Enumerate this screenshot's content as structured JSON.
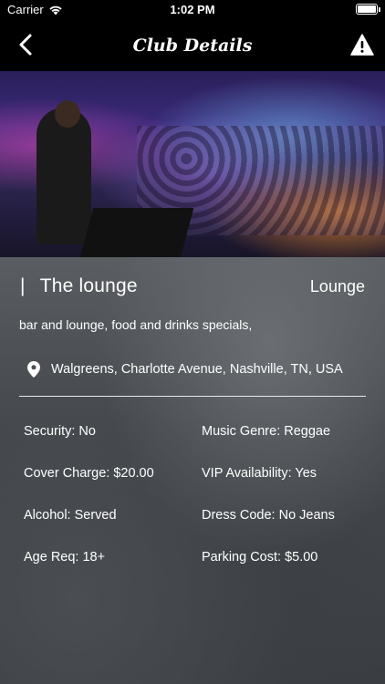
{
  "status_bar": {
    "carrier": "Carrier",
    "time": "1:02 PM",
    "battery_level": 1.0
  },
  "nav": {
    "title": "Club Details",
    "back_icon": "chevron-left-icon",
    "warning_icon": "warning-icon"
  },
  "club": {
    "name_prefix": "|",
    "name": "The lounge",
    "type": "Lounge",
    "description": "bar and lounge, food and drinks specials,",
    "address": "Walgreens, Charlotte Avenue, Nashville, TN, USA"
  },
  "details": {
    "security": "Security: No",
    "music_genre": "Music Genre: Reggae",
    "cover_charge": "Cover Charge: $20.00",
    "vip_availability": "VIP Availability: Yes",
    "alcohol": "Alcohol: Served",
    "dress_code": "Dress Code: No Jeans",
    "age_req": "Age Req: 18+",
    "parking_cost": "Parking Cost: $5.00"
  }
}
